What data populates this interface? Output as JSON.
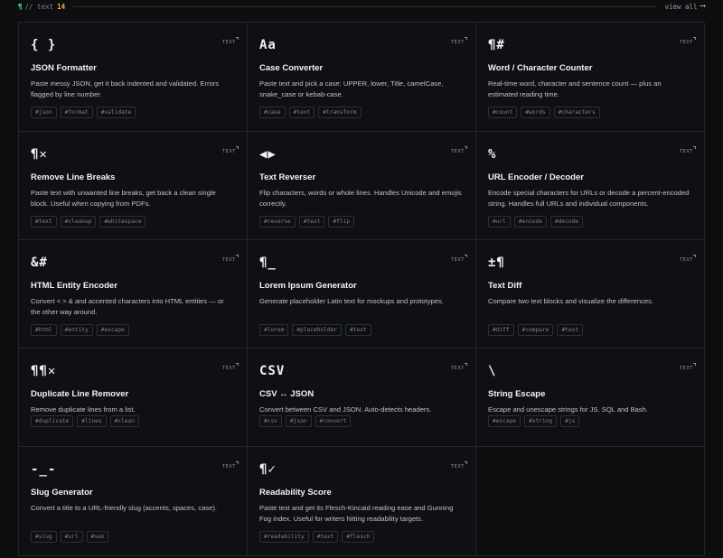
{
  "header": {
    "pilcrow": "¶",
    "breadcrumb": "// text",
    "count": "14",
    "view_all": "view all",
    "arrow": "⟶"
  },
  "badge_label": "TEXT",
  "tools": [
    {
      "glyph": "{ }",
      "title": "JSON Formatter",
      "desc": "Paste messy JSON, get it back indented and validated. Errors flagged by line number.",
      "tags": [
        "#json",
        "#format",
        "#validate"
      ]
    },
    {
      "glyph": "Aa",
      "title": "Case Converter",
      "desc": "Paste text and pick a case: UPPER, lower, Title, camelCase, snake_case or kebab-case.",
      "tags": [
        "#case",
        "#text",
        "#transform"
      ]
    },
    {
      "glyph": "¶#",
      "title": "Word / Character Counter",
      "desc": "Real-time word, character and sentence count — plus an estimated reading time.",
      "tags": [
        "#count",
        "#words",
        "#characters"
      ]
    },
    {
      "glyph": "¶✕",
      "title": "Remove Line Breaks",
      "desc": "Paste text with unwanted line breaks, get back a clean single block. Useful when copying from PDFs.",
      "tags": [
        "#text",
        "#cleanup",
        "#whitespace"
      ]
    },
    {
      "glyph": "◀▶",
      "title": "Text Reverser",
      "desc": "Flip characters, words or whole lines. Handles Unicode and emojis correctly.",
      "tags": [
        "#reverse",
        "#text",
        "#flip"
      ]
    },
    {
      "glyph": "%",
      "title": "URL Encoder / Decoder",
      "desc": "Encode special characters for URLs or decode a percent-encoded string. Handles full URLs and individual components.",
      "tags": [
        "#url",
        "#encode",
        "#decode"
      ]
    },
    {
      "glyph": "&#",
      "title": "HTML Entity Encoder",
      "desc": "Convert < > & and accented characters into HTML entities — or the other way around.",
      "tags": [
        "#html",
        "#entity",
        "#escape"
      ]
    },
    {
      "glyph": "¶_",
      "title": "Lorem Ipsum Generator",
      "desc": "Generate placeholder Latin text for mockups and prototypes.",
      "tags": [
        "#lorem",
        "#placeholder",
        "#text"
      ]
    },
    {
      "glyph": "±¶",
      "title": "Text Diff",
      "desc": "Compare two text blocks and visualize the differences.",
      "tags": [
        "#diff",
        "#compare",
        "#text"
      ]
    },
    {
      "glyph": "¶¶✕",
      "title": "Duplicate Line Remover",
      "desc": "Remove duplicate lines from a list.",
      "tags": [
        "#duplicate",
        "#lines",
        "#clean"
      ]
    },
    {
      "glyph": "CSV",
      "title": "CSV ↔ JSON",
      "desc": "Convert between CSV and JSON. Auto-detects headers.",
      "tags": [
        "#csv",
        "#json",
        "#convert"
      ]
    },
    {
      "glyph": "\\",
      "title": "String Escape",
      "desc": "Escape and unescape strings for JS, SQL and Bash.",
      "tags": [
        "#escape",
        "#string",
        "#js"
      ]
    },
    {
      "glyph": "-_-",
      "title": "Slug Generator",
      "desc": "Convert a title to a URL-friendly slug (accents, spaces, case).",
      "tags": [
        "#slug",
        "#url",
        "#seo"
      ]
    },
    {
      "glyph": "¶✓",
      "title": "Readability Score",
      "desc": "Paste text and get its Flesch-Kincaid reading ease and Gunning Fog index. Useful for writers hitting readability targets.",
      "tags": [
        "#readability",
        "#text",
        "#flesch"
      ]
    }
  ],
  "colors": {
    "accent_green": "#44e5a0",
    "accent_amber": "#f3b332",
    "background": "#0d0e10"
  }
}
